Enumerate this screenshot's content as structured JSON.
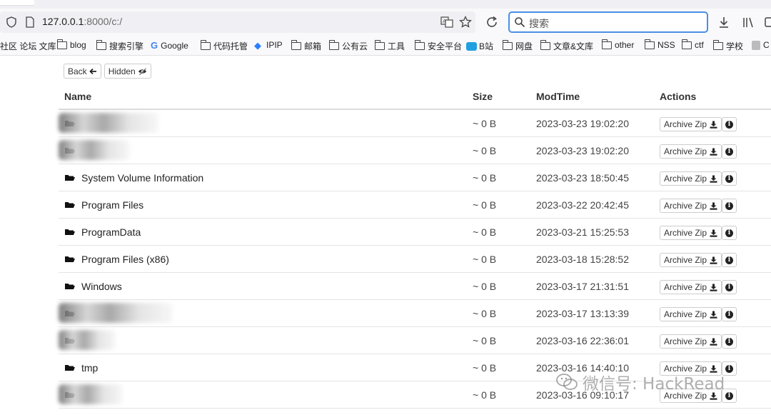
{
  "browser": {
    "url_host": "127.0.0.1",
    "url_rest": ":8000/c:/",
    "search_placeholder": "搜索"
  },
  "bookmarks": [
    {
      "label": "社区 论坛 文库",
      "icon": "none"
    },
    {
      "label": "blog",
      "icon": "folder-icon"
    },
    {
      "label": "搜索引擎",
      "icon": "folder-icon"
    },
    {
      "label": "Google",
      "icon": "google-icon"
    },
    {
      "label": "代码托管",
      "icon": "folder-icon"
    },
    {
      "label": "IPIP",
      "icon": "ipip-icon"
    },
    {
      "label": "邮箱",
      "icon": "folder-icon"
    },
    {
      "label": "公有云",
      "icon": "folder-icon"
    },
    {
      "label": "工具",
      "icon": "folder-icon"
    },
    {
      "label": "安全平台",
      "icon": "folder-icon"
    },
    {
      "label": "B站",
      "icon": "bilibili-icon"
    },
    {
      "label": "网盘",
      "icon": "folder-icon"
    },
    {
      "label": "文章&文库",
      "icon": "folder-icon"
    },
    {
      "label": "other",
      "icon": "folder-icon"
    },
    {
      "label": "NSS",
      "icon": "folder-icon"
    },
    {
      "label": "ctf",
      "icon": "folder-icon"
    },
    {
      "label": "学校",
      "icon": "folder-icon"
    },
    {
      "label": "C",
      "icon": "cup-icon"
    }
  ],
  "toolbar": {
    "back_label": "Back",
    "hidden_label": "Hidden"
  },
  "table": {
    "headers": {
      "name": "Name",
      "size": "Size",
      "modtime": "ModTime",
      "actions": "Actions"
    },
    "archive_label": "Archive Zip",
    "rows": [
      {
        "name": "",
        "size": "~ 0 B",
        "modtime": "2023-03-23 19:02:20",
        "redacted": true
      },
      {
        "name": "",
        "size": "~ 0 B",
        "modtime": "2023-03-23 19:02:20",
        "redacted": true
      },
      {
        "name": "System Volume Information",
        "size": "~ 0 B",
        "modtime": "2023-03-23 18:50:45",
        "redacted": false
      },
      {
        "name": "Program Files",
        "size": "~ 0 B",
        "modtime": "2023-03-22 20:42:45",
        "redacted": false
      },
      {
        "name": "ProgramData",
        "size": "~ 0 B",
        "modtime": "2023-03-21 15:25:53",
        "redacted": false
      },
      {
        "name": "Program Files (x86)",
        "size": "~ 0 B",
        "modtime": "2023-03-18 15:28:52",
        "redacted": false
      },
      {
        "name": "Windows",
        "size": "~ 0 B",
        "modtime": "2023-03-17 21:31:51",
        "redacted": false
      },
      {
        "name": "",
        "size": "~ 0 B",
        "modtime": "2023-03-17 13:13:39",
        "redacted": true
      },
      {
        "name": "",
        "size": "~ 0 B",
        "modtime": "2023-03-16 22:36:01",
        "redacted": true
      },
      {
        "name": "tmp",
        "size": "~ 0 B",
        "modtime": "2023-03-16 14:40:10",
        "redacted": false
      },
      {
        "name": "",
        "size": "~ 0 B",
        "modtime": "2023-03-16 09:10:17",
        "redacted": true
      }
    ]
  },
  "watermark": {
    "text": "微信号: HackRead"
  },
  "colors": {
    "search_border": "#4a90e2",
    "header_rule": "#dcdcdc"
  }
}
